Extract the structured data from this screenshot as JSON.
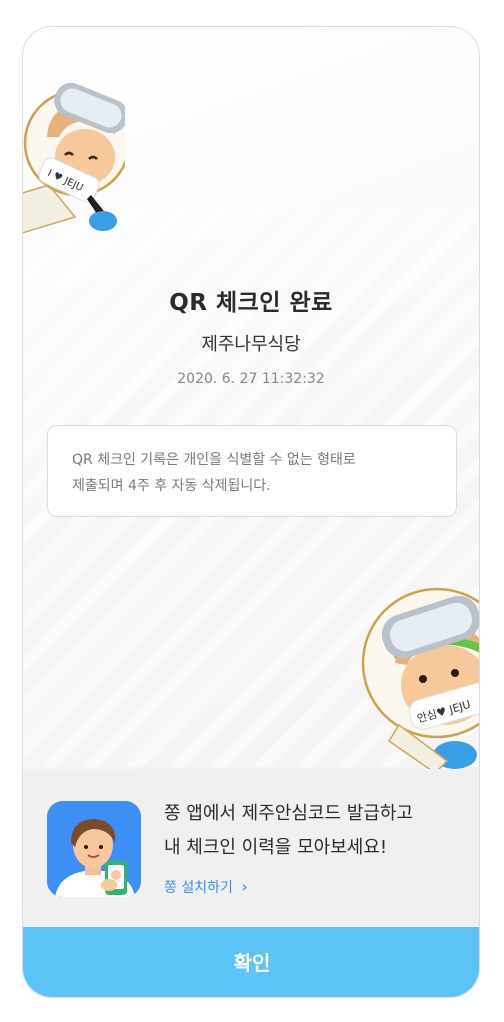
{
  "checkin": {
    "title": "QR 체크인 완료",
    "store_name": "제주나무식당",
    "datetime": "2020. 6. 27 11:32:32"
  },
  "notice": {
    "line1": "QR 체크인 기록은 개인을 식별할 수 없는 형태로",
    "line2": "제출되며 4주 후 자동 삭제됩니다."
  },
  "promo": {
    "line1": "쫑 앱에서 제주안심코드 발급하고",
    "line2": "내 체크인 이력을 모아보세요!",
    "link_label": "쫑 설치하기",
    "link_chevron": "›",
    "app_icon": "jjong-app-icon"
  },
  "mascot": {
    "top_badge": "I ♥ JEJU",
    "bottom_badge": "안심♥ JEJU"
  },
  "buttons": {
    "confirm_label": "확인"
  },
  "colors": {
    "confirm_bg": "#5bc3f6",
    "link": "#3a8de0",
    "app_icon_bg": "#3d8ef5",
    "mascot_glove": "#3a9ee6"
  }
}
